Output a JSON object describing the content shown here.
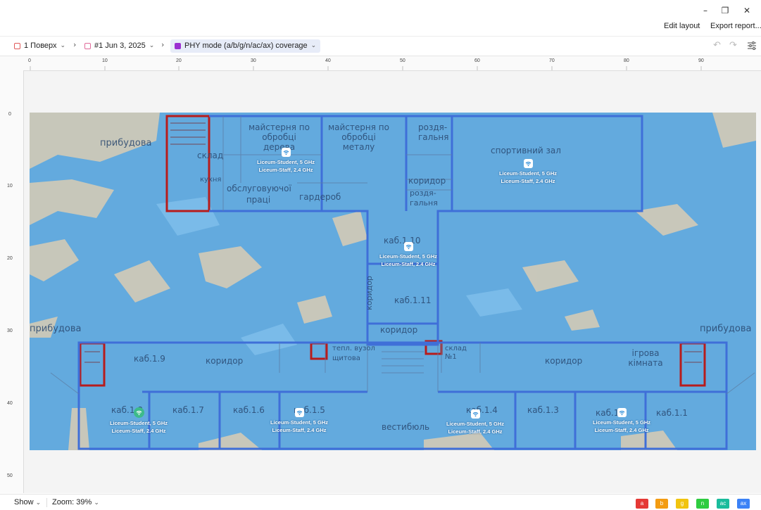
{
  "window": {
    "minimize": "–",
    "restore": "❐",
    "close": "✕"
  },
  "toolbar": {
    "edit_layout": "Edit layout",
    "export_report": "Export report..."
  },
  "breadcrumb": {
    "floor": "1 Поверх",
    "survey": "#1 Jun 3, 2025",
    "view": "PHY mode (a/b/g/n/ac/ax) coverage"
  },
  "ruler": {
    "top": [
      "0",
      "10",
      "20",
      "30",
      "40",
      "50",
      "60",
      "70",
      "80",
      "90"
    ],
    "left": [
      "0",
      "10",
      "20",
      "30",
      "40",
      "50"
    ]
  },
  "access_points": [
    {
      "ssid_5": "Liceum-Student, 5 GHz",
      "ssid_24": "Liceum-Staff, 2.4 GHz",
      "style": "white"
    },
    {
      "ssid_5": "Liceum-Student, 5 GHz",
      "ssid_24": "Liceum-Staff, 2.4 GHz",
      "style": "white"
    },
    {
      "ssid_5": "Liceum-Student, 5 GHz",
      "ssid_24": "Liceum-Staff, 2.4 GHz",
      "style": "white"
    },
    {
      "ssid_5": "Liceum-Student, 5 GHz",
      "ssid_24": "Liceum-Staff, 2.4 GHz",
      "style": "green"
    },
    {
      "ssid_5": "Liceum-Student, 5 GHz",
      "ssid_24": "Liceum-Staff, 2.4 GHz",
      "style": "white"
    },
    {
      "ssid_5": "Liceum-Student, 5 GHz",
      "ssid_24": "Liceum-Staff, 2.4 GHz",
      "style": "white"
    },
    {
      "ssid_5": "Liceum-Student, 5 GHz",
      "ssid_24": "Liceum-Staff, 2.4 GHz",
      "style": "white"
    }
  ],
  "rooms": [
    "прибудова",
    "майстерня по обробці дерева",
    "майстерня по обробці металу",
    "роздя-гальня",
    "спортивний зал",
    "склад",
    "кухня",
    "обслуговуючої праці",
    "гардероб",
    "коридор",
    "роздя-гальня",
    "каб.1.10",
    "коридор",
    "каб.1.11",
    "коридор",
    "прибудова",
    "прибудова",
    "каб.1.9",
    "коридор",
    "тепл. вузол",
    "щитова",
    "склад №1",
    "коридор",
    "ігрова кімната",
    "каб.1.8",
    "каб.1.7",
    "каб.1.6",
    "каб.1.5",
    "вестибюль",
    "каб.1.4",
    "каб.1.3",
    "каб.1.2",
    "каб.1.1"
  ],
  "status": {
    "show": "Show",
    "zoom": "Zoom: 39%"
  },
  "legend": [
    {
      "label": "a",
      "color": "#e53935"
    },
    {
      "label": "b",
      "color": "#f39c12"
    },
    {
      "label": "g",
      "color": "#f1c40f"
    },
    {
      "label": "n",
      "color": "#2ecc40"
    },
    {
      "label": "ac",
      "color": "#1abc9c"
    },
    {
      "label": "ax",
      "color": "#3b82f6"
    }
  ],
  "colors": {
    "coverage": "#4aa3e8",
    "wall_red": "#b71c1c",
    "wall_blue": "#3f6fd8",
    "accent": "#2f6fdb"
  }
}
